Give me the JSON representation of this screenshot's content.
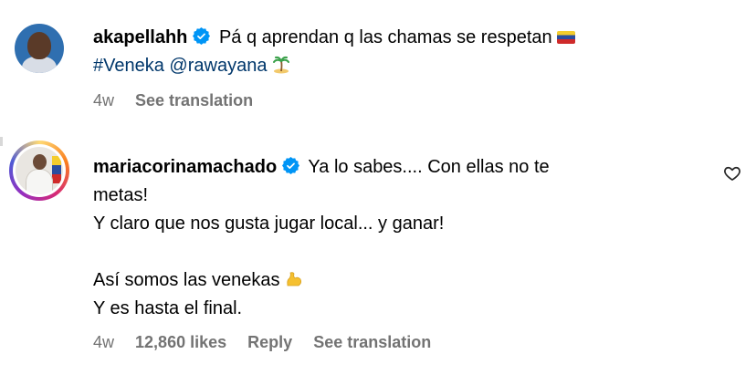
{
  "comments": [
    {
      "username": "akapellahh",
      "verified": true,
      "text_main": "Pá q aprendan q las chamas se respetan",
      "hashtag": "#Veneka",
      "mention": "@rawayana",
      "emojis": [
        "venezuela-flag",
        "island"
      ],
      "age": "4w",
      "see_translation": "See translation"
    },
    {
      "username": "mariacorinamachado",
      "verified": true,
      "line1": "Ya lo sabes.... Con ellas no te",
      "line2": "metas!",
      "line3": "Y claro que nos gusta jugar local... y ganar!",
      "line4": "Así somos las venekas",
      "line5": "Y es hasta el final.",
      "emojis": [
        "flexed-biceps"
      ],
      "age": "4w",
      "likes": "12,860 likes",
      "reply": "Reply",
      "see_translation": "See translation"
    }
  ],
  "colors": {
    "text": "#000000",
    "meta": "#737373",
    "link": "#00376b",
    "verified": "#0095f6"
  }
}
